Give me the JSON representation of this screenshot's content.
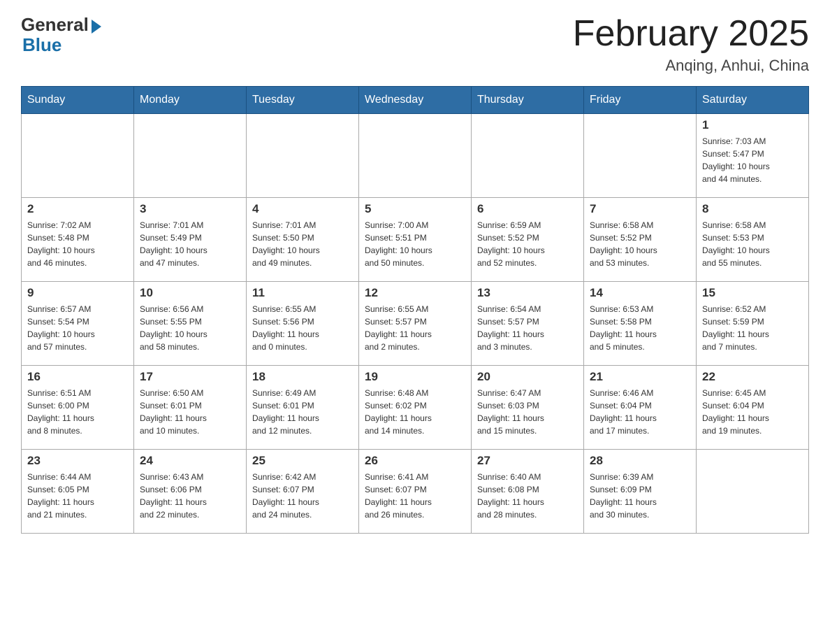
{
  "header": {
    "logo_general": "General",
    "logo_blue": "Blue",
    "month_title": "February 2025",
    "location": "Anqing, Anhui, China"
  },
  "days_of_week": [
    "Sunday",
    "Monday",
    "Tuesday",
    "Wednesday",
    "Thursday",
    "Friday",
    "Saturday"
  ],
  "weeks": [
    {
      "days": [
        {
          "number": "",
          "info": ""
        },
        {
          "number": "",
          "info": ""
        },
        {
          "number": "",
          "info": ""
        },
        {
          "number": "",
          "info": ""
        },
        {
          "number": "",
          "info": ""
        },
        {
          "number": "",
          "info": ""
        },
        {
          "number": "1",
          "info": "Sunrise: 7:03 AM\nSunset: 5:47 PM\nDaylight: 10 hours\nand 44 minutes."
        }
      ]
    },
    {
      "days": [
        {
          "number": "2",
          "info": "Sunrise: 7:02 AM\nSunset: 5:48 PM\nDaylight: 10 hours\nand 46 minutes."
        },
        {
          "number": "3",
          "info": "Sunrise: 7:01 AM\nSunset: 5:49 PM\nDaylight: 10 hours\nand 47 minutes."
        },
        {
          "number": "4",
          "info": "Sunrise: 7:01 AM\nSunset: 5:50 PM\nDaylight: 10 hours\nand 49 minutes."
        },
        {
          "number": "5",
          "info": "Sunrise: 7:00 AM\nSunset: 5:51 PM\nDaylight: 10 hours\nand 50 minutes."
        },
        {
          "number": "6",
          "info": "Sunrise: 6:59 AM\nSunset: 5:52 PM\nDaylight: 10 hours\nand 52 minutes."
        },
        {
          "number": "7",
          "info": "Sunrise: 6:58 AM\nSunset: 5:52 PM\nDaylight: 10 hours\nand 53 minutes."
        },
        {
          "number": "8",
          "info": "Sunrise: 6:58 AM\nSunset: 5:53 PM\nDaylight: 10 hours\nand 55 minutes."
        }
      ]
    },
    {
      "days": [
        {
          "number": "9",
          "info": "Sunrise: 6:57 AM\nSunset: 5:54 PM\nDaylight: 10 hours\nand 57 minutes."
        },
        {
          "number": "10",
          "info": "Sunrise: 6:56 AM\nSunset: 5:55 PM\nDaylight: 10 hours\nand 58 minutes."
        },
        {
          "number": "11",
          "info": "Sunrise: 6:55 AM\nSunset: 5:56 PM\nDaylight: 11 hours\nand 0 minutes."
        },
        {
          "number": "12",
          "info": "Sunrise: 6:55 AM\nSunset: 5:57 PM\nDaylight: 11 hours\nand 2 minutes."
        },
        {
          "number": "13",
          "info": "Sunrise: 6:54 AM\nSunset: 5:57 PM\nDaylight: 11 hours\nand 3 minutes."
        },
        {
          "number": "14",
          "info": "Sunrise: 6:53 AM\nSunset: 5:58 PM\nDaylight: 11 hours\nand 5 minutes."
        },
        {
          "number": "15",
          "info": "Sunrise: 6:52 AM\nSunset: 5:59 PM\nDaylight: 11 hours\nand 7 minutes."
        }
      ]
    },
    {
      "days": [
        {
          "number": "16",
          "info": "Sunrise: 6:51 AM\nSunset: 6:00 PM\nDaylight: 11 hours\nand 8 minutes."
        },
        {
          "number": "17",
          "info": "Sunrise: 6:50 AM\nSunset: 6:01 PM\nDaylight: 11 hours\nand 10 minutes."
        },
        {
          "number": "18",
          "info": "Sunrise: 6:49 AM\nSunset: 6:01 PM\nDaylight: 11 hours\nand 12 minutes."
        },
        {
          "number": "19",
          "info": "Sunrise: 6:48 AM\nSunset: 6:02 PM\nDaylight: 11 hours\nand 14 minutes."
        },
        {
          "number": "20",
          "info": "Sunrise: 6:47 AM\nSunset: 6:03 PM\nDaylight: 11 hours\nand 15 minutes."
        },
        {
          "number": "21",
          "info": "Sunrise: 6:46 AM\nSunset: 6:04 PM\nDaylight: 11 hours\nand 17 minutes."
        },
        {
          "number": "22",
          "info": "Sunrise: 6:45 AM\nSunset: 6:04 PM\nDaylight: 11 hours\nand 19 minutes."
        }
      ]
    },
    {
      "days": [
        {
          "number": "23",
          "info": "Sunrise: 6:44 AM\nSunset: 6:05 PM\nDaylight: 11 hours\nand 21 minutes."
        },
        {
          "number": "24",
          "info": "Sunrise: 6:43 AM\nSunset: 6:06 PM\nDaylight: 11 hours\nand 22 minutes."
        },
        {
          "number": "25",
          "info": "Sunrise: 6:42 AM\nSunset: 6:07 PM\nDaylight: 11 hours\nand 24 minutes."
        },
        {
          "number": "26",
          "info": "Sunrise: 6:41 AM\nSunset: 6:07 PM\nDaylight: 11 hours\nand 26 minutes."
        },
        {
          "number": "27",
          "info": "Sunrise: 6:40 AM\nSunset: 6:08 PM\nDaylight: 11 hours\nand 28 minutes."
        },
        {
          "number": "28",
          "info": "Sunrise: 6:39 AM\nSunset: 6:09 PM\nDaylight: 11 hours\nand 30 minutes."
        },
        {
          "number": "",
          "info": ""
        }
      ]
    }
  ]
}
